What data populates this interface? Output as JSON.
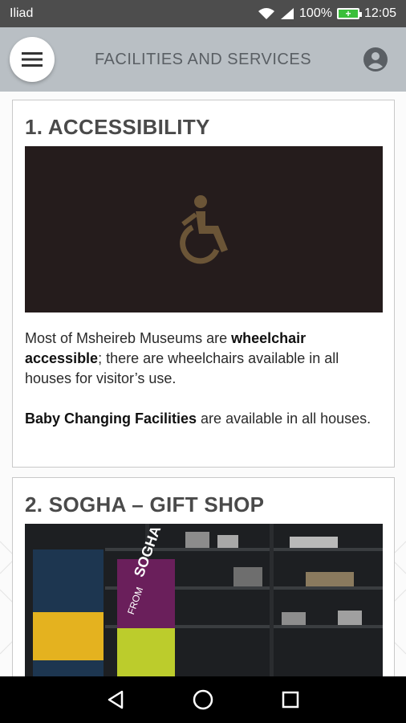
{
  "status_bar": {
    "carrier": "Iliad",
    "battery": "100%",
    "time": "12:05"
  },
  "header": {
    "title": "FACILITIES AND SERVICES",
    "menu_icon": "menu-icon",
    "user_icon": "account-circle-icon"
  },
  "cards": [
    {
      "title": "1. ACCESSIBILITY",
      "image_icon": "wheelchair-icon",
      "paragraph1": {
        "pre": "Most of Msheireb Museums are ",
        "bold": "wheelchair accessible",
        "post": "; there are wheelchairs available in all houses for visitor’s use."
      },
      "paragraph2": {
        "bold": "Baby Changing Facilities",
        "post": " are available in all houses."
      }
    },
    {
      "title": "2. SOGHA – GIFT SHOP",
      "image_text_1": "SOGHA",
      "image_text_2": "FROM"
    }
  ],
  "nav": {
    "back_icon": "back-triangle-icon",
    "home_icon": "home-circle-icon",
    "recents_icon": "recents-square-icon"
  },
  "colors": {
    "header_bg": "#b9bfc4",
    "status_bg": "#4d4d4d",
    "image_bg": "#251c1c",
    "wheelchair": "#6b5537"
  }
}
